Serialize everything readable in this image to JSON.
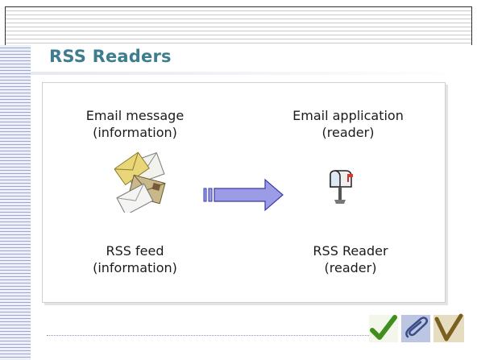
{
  "slide": {
    "title": "RSS Readers"
  },
  "captions": {
    "email_message": "Email message",
    "email_message_sub": "(information)",
    "email_application": "Email application",
    "email_application_sub": "(reader)",
    "rss_feed": "RSS feed",
    "rss_feed_sub": "(information)",
    "rss_reader": "RSS Reader",
    "rss_reader_sub": "(reader)"
  },
  "icons": {
    "envelopes": "envelopes-icon",
    "arrow": "right-arrow-icon",
    "mailbox": "mailbox-icon",
    "footer": [
      "checkmark-icon",
      "paperclip-icon",
      "check-v-icon"
    ]
  },
  "colors": {
    "title": "#3d7d8f",
    "arrow_fill": "#9b9be6",
    "arrow_stroke": "#3a3aa8",
    "left_stripes": "#9aa6cf",
    "top_stripes": "#c9c9c9"
  }
}
